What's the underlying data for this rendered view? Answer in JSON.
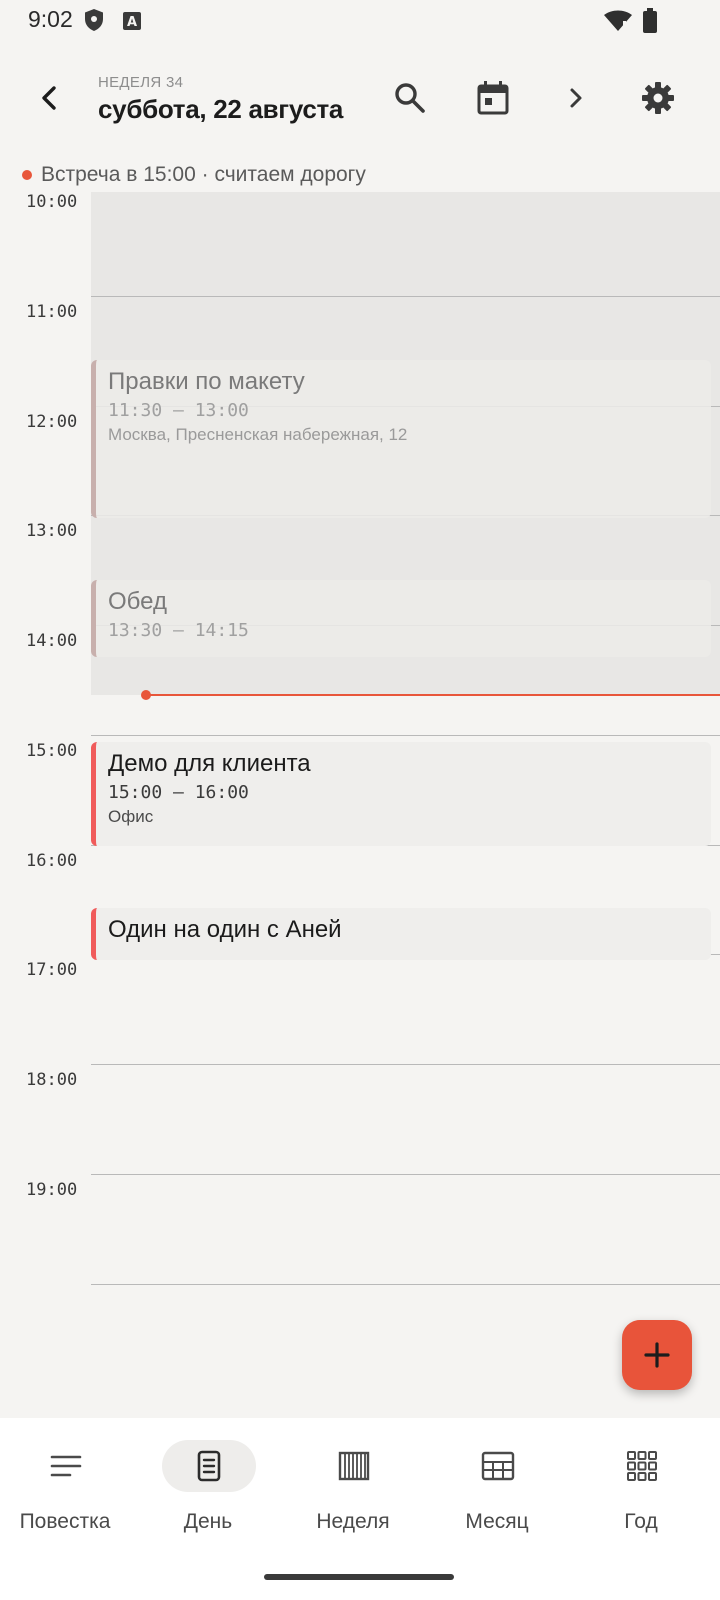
{
  "status_bar": {
    "time": "9:02"
  },
  "header": {
    "week_label": "НЕДЕЛЯ 34",
    "date_title": "суббота, 22 августа"
  },
  "notice": {
    "text": "Встреча в 15:00 · считаем дорогу"
  },
  "timeline": {
    "hours": [
      "10:00",
      "11:00",
      "12:00",
      "13:00",
      "14:00",
      "15:00",
      "16:00",
      "17:00",
      "18:00",
      "19:00"
    ],
    "events": [
      {
        "title": "Правки по макету",
        "time": "11:30 – 13:00",
        "location": "Москва, Пресненская набережная, 12",
        "state": "past"
      },
      {
        "title": "Обед",
        "time": "13:30 – 14:15",
        "location": "",
        "state": "past"
      },
      {
        "title": "Демо для клиента",
        "time": "15:00 – 16:00",
        "location": "Офис",
        "state": "upcoming"
      },
      {
        "title": "Один на один с Аней",
        "time": "",
        "location": "",
        "state": "upcoming"
      }
    ]
  },
  "bottom_nav": {
    "items": [
      {
        "label": "Повестка",
        "icon": "agenda-icon"
      },
      {
        "label": "День",
        "icon": "day-icon",
        "active": true
      },
      {
        "label": "Неделя",
        "icon": "week-icon"
      },
      {
        "label": "Месяц",
        "icon": "month-icon"
      },
      {
        "label": "Год",
        "icon": "year-icon"
      }
    ]
  },
  "colors": {
    "accent": "#e8543a",
    "event_bar": "#f05b5b",
    "background": "#f5f4f2"
  }
}
